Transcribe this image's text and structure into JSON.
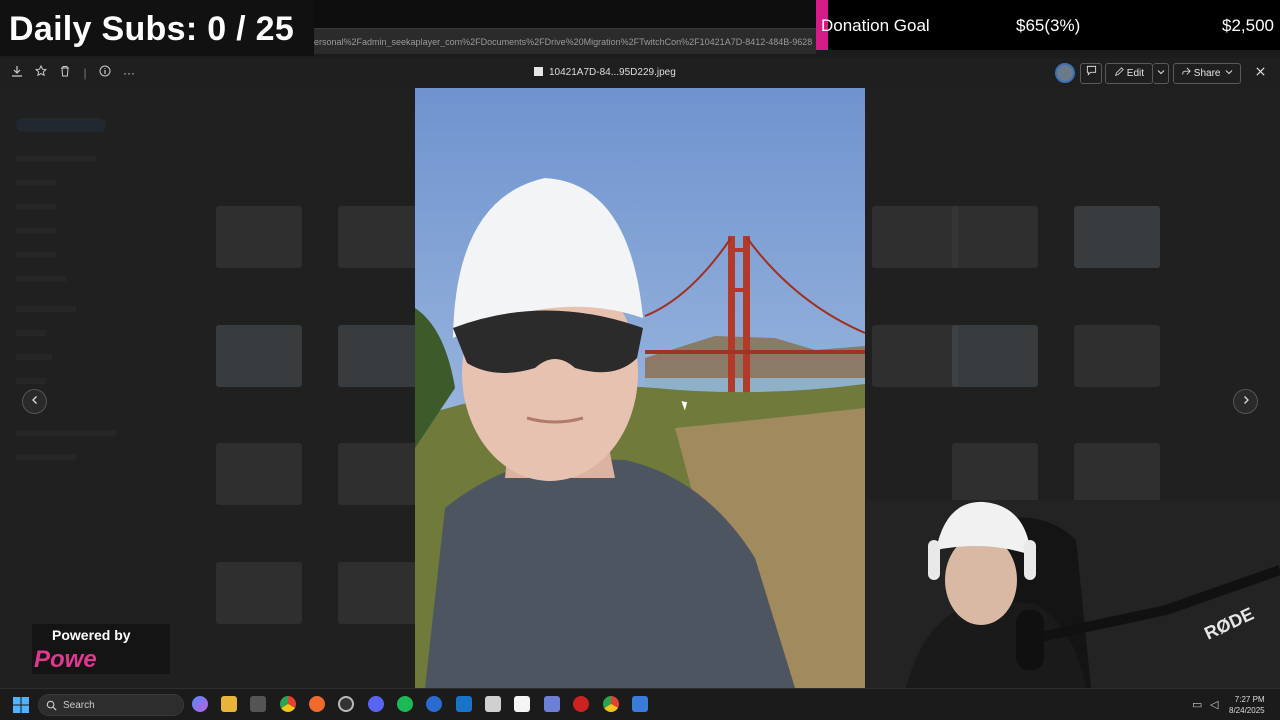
{
  "overlay": {
    "daily_subs": "Daily Subs: 0 / 25",
    "donation_label": "Donation Goal",
    "donation_amount": "$65(3%)",
    "donation_target": "$2,500",
    "donation_accent": "#d41b87"
  },
  "browser": {
    "url_fragment": "ersonal%2Fadmin_seekaplayer_com%2FDocuments%2FDrive%20Migration%2FTwitchCon%2F10421A7D-8412-484B-9628"
  },
  "viewer": {
    "filename": "10421A7D-84...95D229.jpeg",
    "edit_label": "Edit",
    "share_label": "Share",
    "left_icons": [
      "download-icon",
      "star-icon",
      "trash-icon",
      "divider",
      "info-icon",
      "more-icon"
    ],
    "right_icons": [
      "avatar",
      "comment-icon",
      "pencil-icon",
      "chevron-down-icon",
      "share-icon",
      "close-icon"
    ]
  },
  "powered": {
    "title": "Powered by",
    "logo": "Powe"
  },
  "taskbar": {
    "search_label": "Search",
    "time": "7:27 PM",
    "date": "8/24/2025"
  }
}
